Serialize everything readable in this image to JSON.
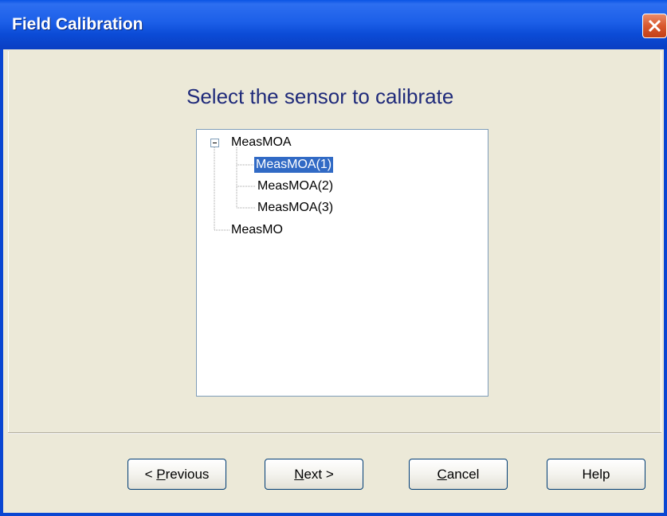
{
  "window": {
    "title": "Field Calibration"
  },
  "heading": "Select the sensor to calibrate",
  "tree": {
    "nodes": [
      {
        "label": "MeasMOA",
        "level": 0,
        "expanded": true,
        "selected": false
      },
      {
        "label": "MeasMOA(1)",
        "level": 1,
        "selected": true
      },
      {
        "label": "MeasMOA(2)",
        "level": 1,
        "selected": false
      },
      {
        "label": "MeasMOA(3)",
        "level": 1,
        "selected": false
      },
      {
        "label": "MeasMO",
        "level": 0,
        "selected": false
      }
    ]
  },
  "buttons": {
    "previous": {
      "prefix": "< ",
      "mnemonic": "P",
      "rest": "revious"
    },
    "next": {
      "mnemonic": "N",
      "rest": "ext >"
    },
    "cancel": {
      "mnemonic": "C",
      "rest": "ancel"
    },
    "help": {
      "label": "Help"
    }
  },
  "colors": {
    "titlebar": "#0a54e4",
    "heading": "#1f2a7a",
    "selection": "#316ac5",
    "background": "#ece9d8"
  },
  "icons": {
    "close": "close-icon",
    "collapse": "minus-box-icon"
  }
}
